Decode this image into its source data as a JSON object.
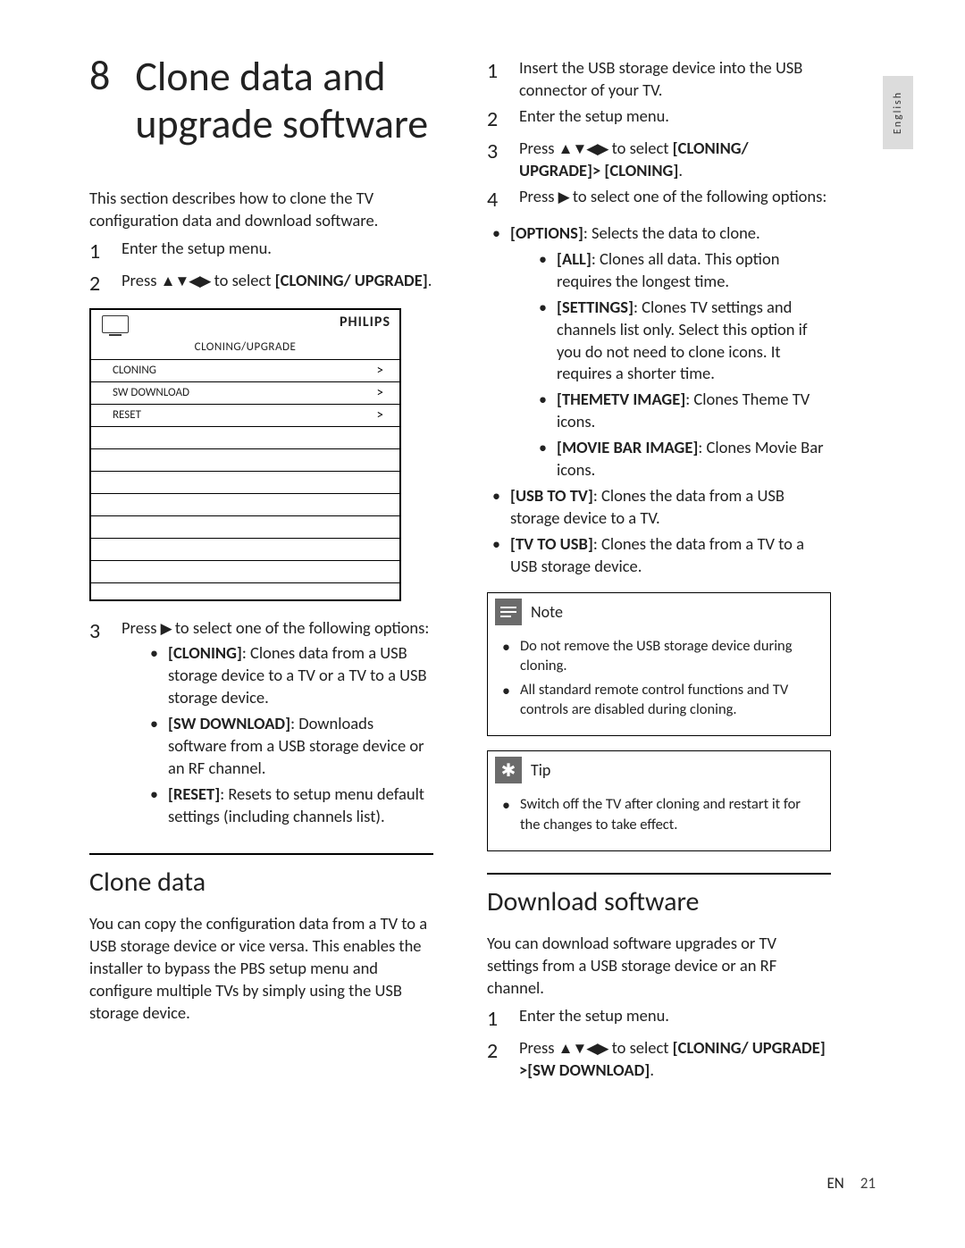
{
  "lang_tab": "English",
  "chapter": {
    "num": "8",
    "title": "Clone data and upgrade software"
  },
  "intro": "This section describes how to clone the TV configuration data and download software.",
  "left_steps": {
    "s1": "Enter the setup menu.",
    "s2_prefix": "Press ",
    "s2_mid": " to select ",
    "s2_bold": "[CLONING/ UPGRADE]",
    "s2_suffix": "."
  },
  "tvui": {
    "brand": "PHILIPS",
    "title": "CLONING/UPGRADE",
    "rows": [
      "CLONING",
      "SW DOWNLOAD",
      "RESET"
    ],
    "caret": ">"
  },
  "left_step3_prefix": "Press ",
  "left_step3_mid": " to select one of the following options:",
  "left_opts": {
    "cloning_b": "[CLONING]",
    "cloning_t": ": Clones data from a USB storage device to a TV or a TV to a USB storage device.",
    "swd_b": "[SW DOWNLOAD]",
    "swd_t": ": Downloads software from a USB storage device or an RF channel.",
    "reset_b": "[RESET]",
    "reset_t": ": Resets to setup menu default settings (including channels list)."
  },
  "sec_clone_title": "Clone data",
  "sec_clone_lead": "You can copy the configuration data from a TV to a USB storage device or vice versa. This enables the installer to bypass the PBS setup menu and configure multiple TVs by simply using the USB storage device.",
  "right_steps": {
    "s1": "Insert the USB storage device into the USB connector of your TV.",
    "s2": "Enter the setup menu.",
    "s3_prefix": "Press ",
    "s3_mid": " to select ",
    "s3_bold": "[CLONING/ UPGRADE]> [CLONING]",
    "s3_suffix": ".",
    "s4_prefix": "Press ",
    "s4_mid": " to select one of the following options:"
  },
  "right_opts": {
    "options_b": "[OPTIONS]",
    "options_t": ": Selects the data to clone.",
    "all_b": "[ALL]",
    "all_t": ": Clones all data. This option requires the longest time.",
    "settings_b": "[SETTINGS]",
    "settings_t": ": Clones TV settings and channels list only. Select this option if you do not need to clone icons. It requires a shorter time.",
    "theme_b": "[THEMETV IMAGE]",
    "theme_t": ": Clones Theme TV icons.",
    "movie_b": "[MOVIE BAR IMAGE]",
    "movie_t": ": Clones Movie Bar icons.",
    "u2t_b": "[USB TO TV]",
    "u2t_t": ": Clones the data from a USB storage device to a TV.",
    "t2u_b": "[TV TO USB]",
    "t2u_t": ": Clones the data from a TV to a USB storage device."
  },
  "note": {
    "title": "Note",
    "l1": "Do not remove the USB storage device during cloning.",
    "l2": "All standard remote control functions and TV controls are disabled during cloning."
  },
  "tip": {
    "title": "Tip",
    "l1": "Switch off the TV after cloning and restart it for the changes to take effect."
  },
  "sec_dl_title": "Download software",
  "sec_dl_lead": "You can download software upgrades or TV settings from a USB storage device or an RF channel.",
  "dl_steps": {
    "s1": "Enter the setup menu.",
    "s2_prefix": "Press ",
    "s2_mid": " to select ",
    "s2_bold": "[CLONING/ UPGRADE] >[SW DOWNLOAD]",
    "s2_suffix": "."
  },
  "footer": {
    "lang": "EN",
    "page": "21"
  },
  "glyph": {
    "nav": "▲▼◀▶",
    "right": "▶",
    "tip": "✱"
  }
}
